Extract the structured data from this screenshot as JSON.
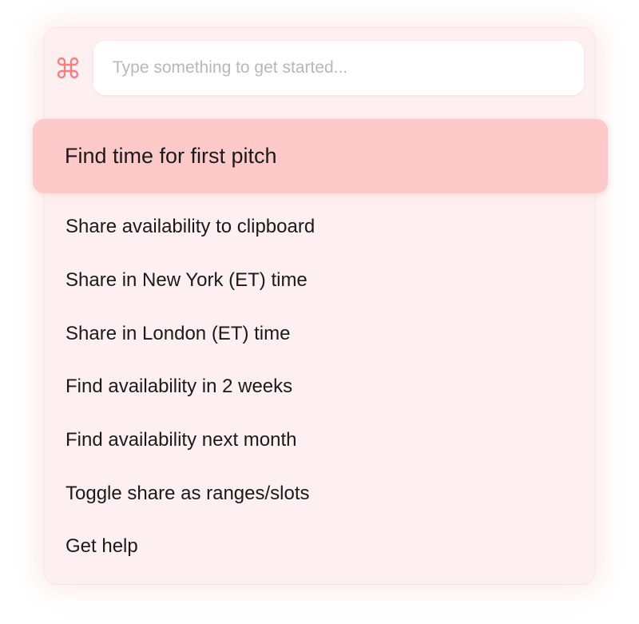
{
  "search": {
    "placeholder": "Type something to get started..."
  },
  "icons": {
    "command": "command-key-icon"
  },
  "colors": {
    "accent": "#f57f7f",
    "panel_bg": "#fef0f0",
    "selected_bg": "#fec9c9"
  },
  "selected": {
    "label": "Find time for first pitch"
  },
  "items": [
    {
      "label": "Share availability to clipboard"
    },
    {
      "label": "Share in New York (ET) time"
    },
    {
      "label": "Share in London (ET) time"
    },
    {
      "label": "Find availability in 2 weeks"
    },
    {
      "label": "Find availability next month"
    },
    {
      "label": "Toggle share as ranges/slots"
    },
    {
      "label": "Get help"
    }
  ]
}
